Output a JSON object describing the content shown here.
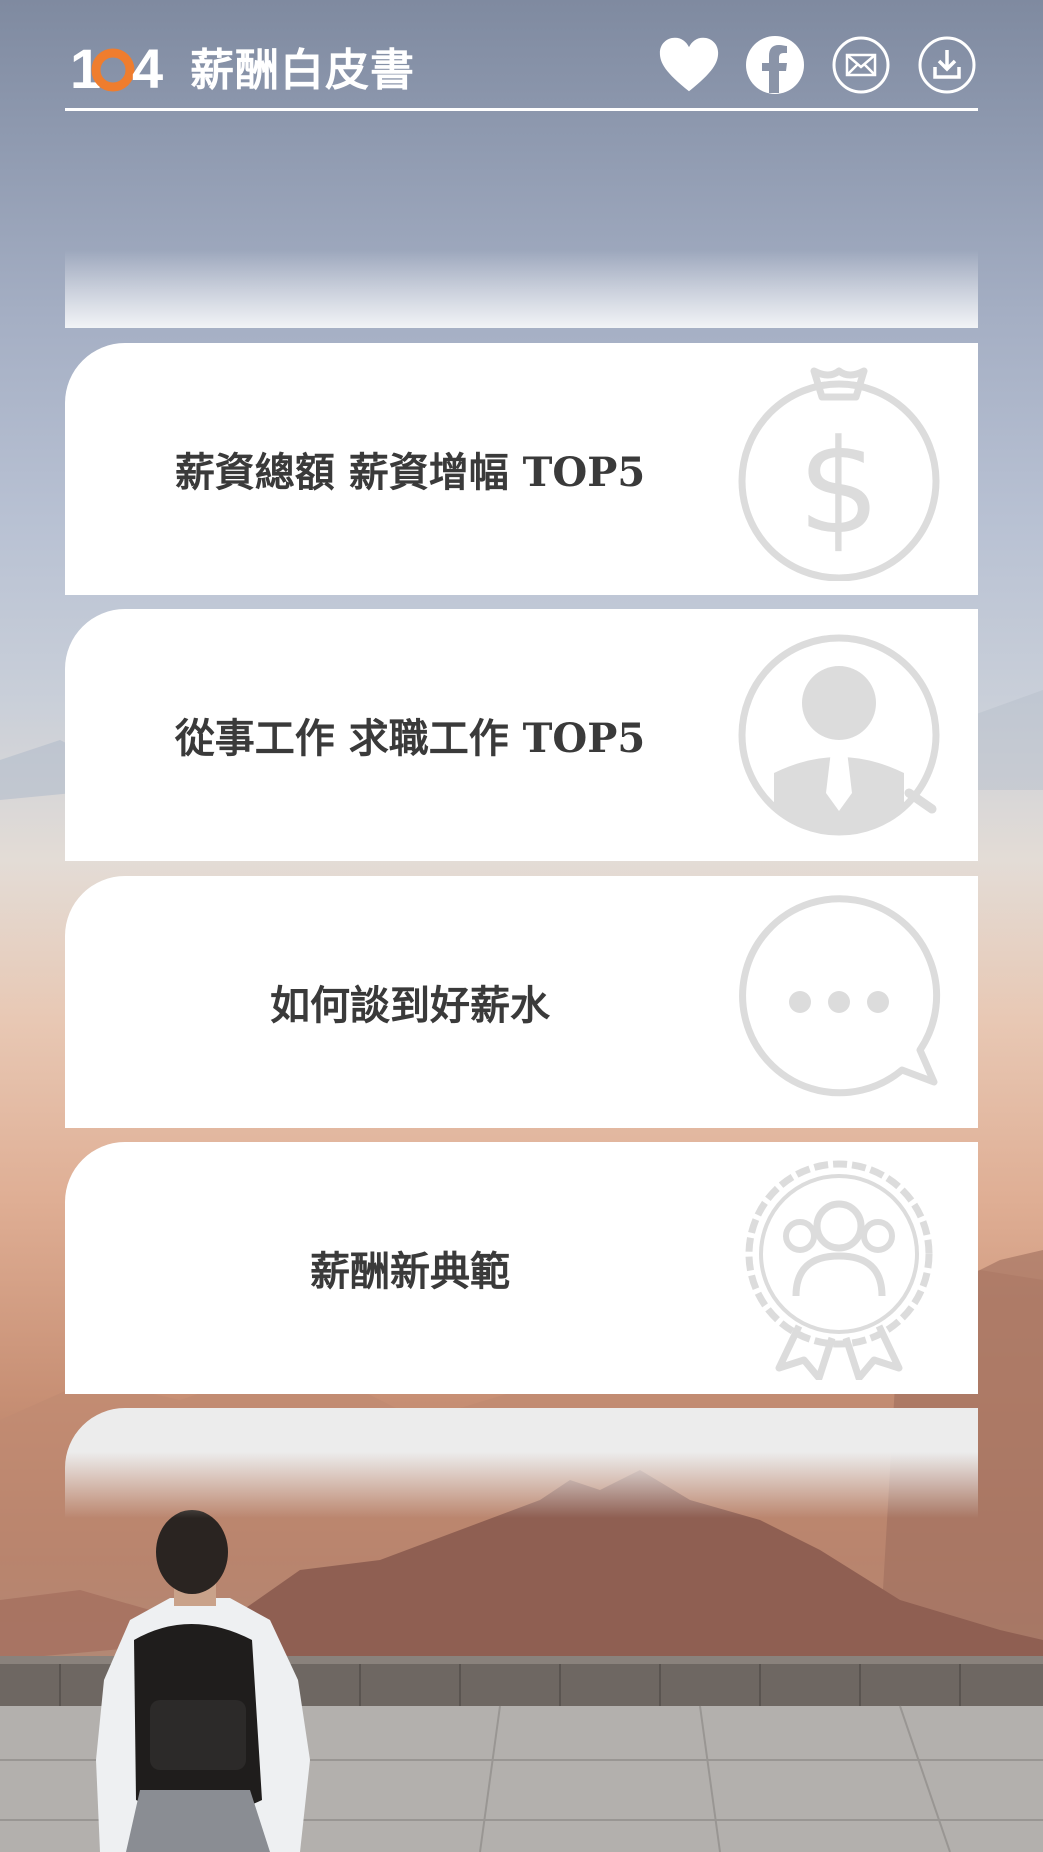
{
  "header": {
    "logo_number": "104",
    "title": "薪酬白皮書",
    "icons": [
      "heart-icon",
      "facebook-icon",
      "mail-icon",
      "download-icon"
    ]
  },
  "cards": [
    {
      "label": "薪資總額 薪資增幅 TOP5",
      "icon": "money-bag-icon"
    },
    {
      "label": "從事工作 求職工作 TOP5",
      "icon": "job-seeker-icon"
    },
    {
      "label": "如何談到好薪水",
      "icon": "chat-bubble-icon"
    },
    {
      "label": "薪酬新典範",
      "icon": "award-badge-icon"
    }
  ],
  "colors": {
    "accent": "#ef7d2e",
    "icon_gray": "#dcdcdc",
    "text": "#3a3a3a"
  }
}
